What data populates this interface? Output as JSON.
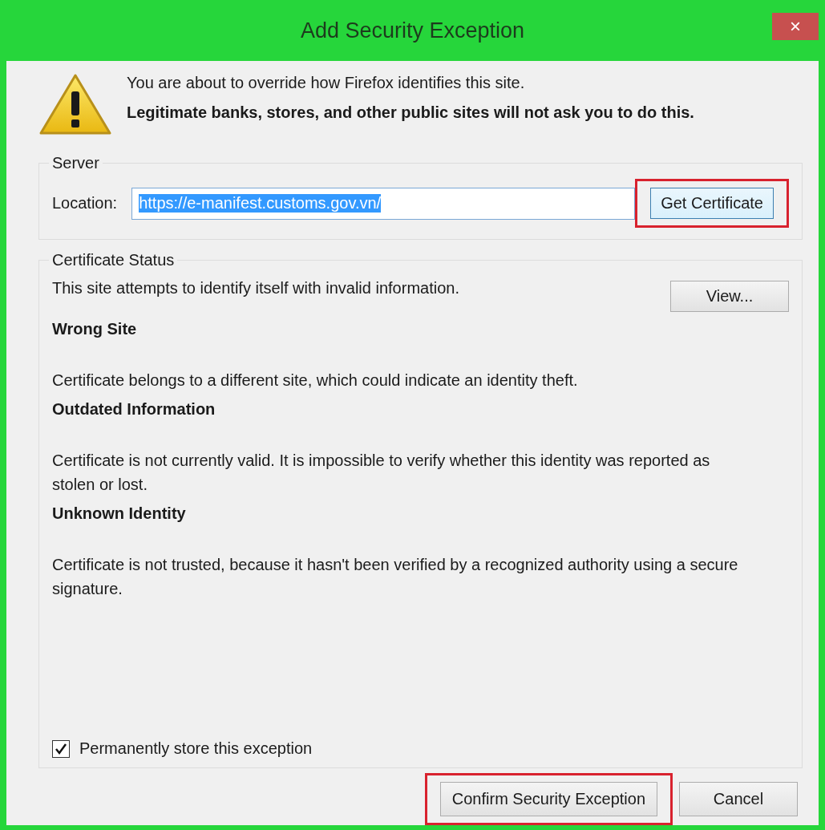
{
  "window": {
    "title": "Add Security Exception",
    "close": "×"
  },
  "intro": {
    "message": "You are about to override how Firefox identifies this site.",
    "warning": "Legitimate banks, stores, and other public sites will not ask you to do this."
  },
  "server": {
    "legend": "Server",
    "location_label": "Location:",
    "location_value": "https://e-manifest.customs.gov.vn/",
    "value_selected": true,
    "button": {
      "label": "Get Certificate",
      "highlighted": true
    }
  },
  "certificate_status": {
    "legend": "Certificate Status",
    "summary": "This site attempts to identify itself with invalid information.",
    "view_button": {
      "label": "View...",
      "highlighted": false
    },
    "problems": [
      {
        "heading": "Wrong Site",
        "text": "Certificate belongs to a different site, which could indicate an identity theft."
      },
      {
        "heading": "Outdated Information",
        "text": "Certificate is not currently valid. It is impossible to verify whether this identity was reported as stolen or lost."
      },
      {
        "heading": "Unknown Identity",
        "text": "Certificate is not trusted, because it hasn't been verified by a recognized authority using a secure signature."
      }
    ],
    "permanent": {
      "label": "Permanently store this exception",
      "checked": true
    }
  },
  "buttons": [
    {
      "label": "Confirm Security Exception",
      "highlighted": true
    },
    {
      "label": "Cancel",
      "highlighted": false
    }
  ]
}
